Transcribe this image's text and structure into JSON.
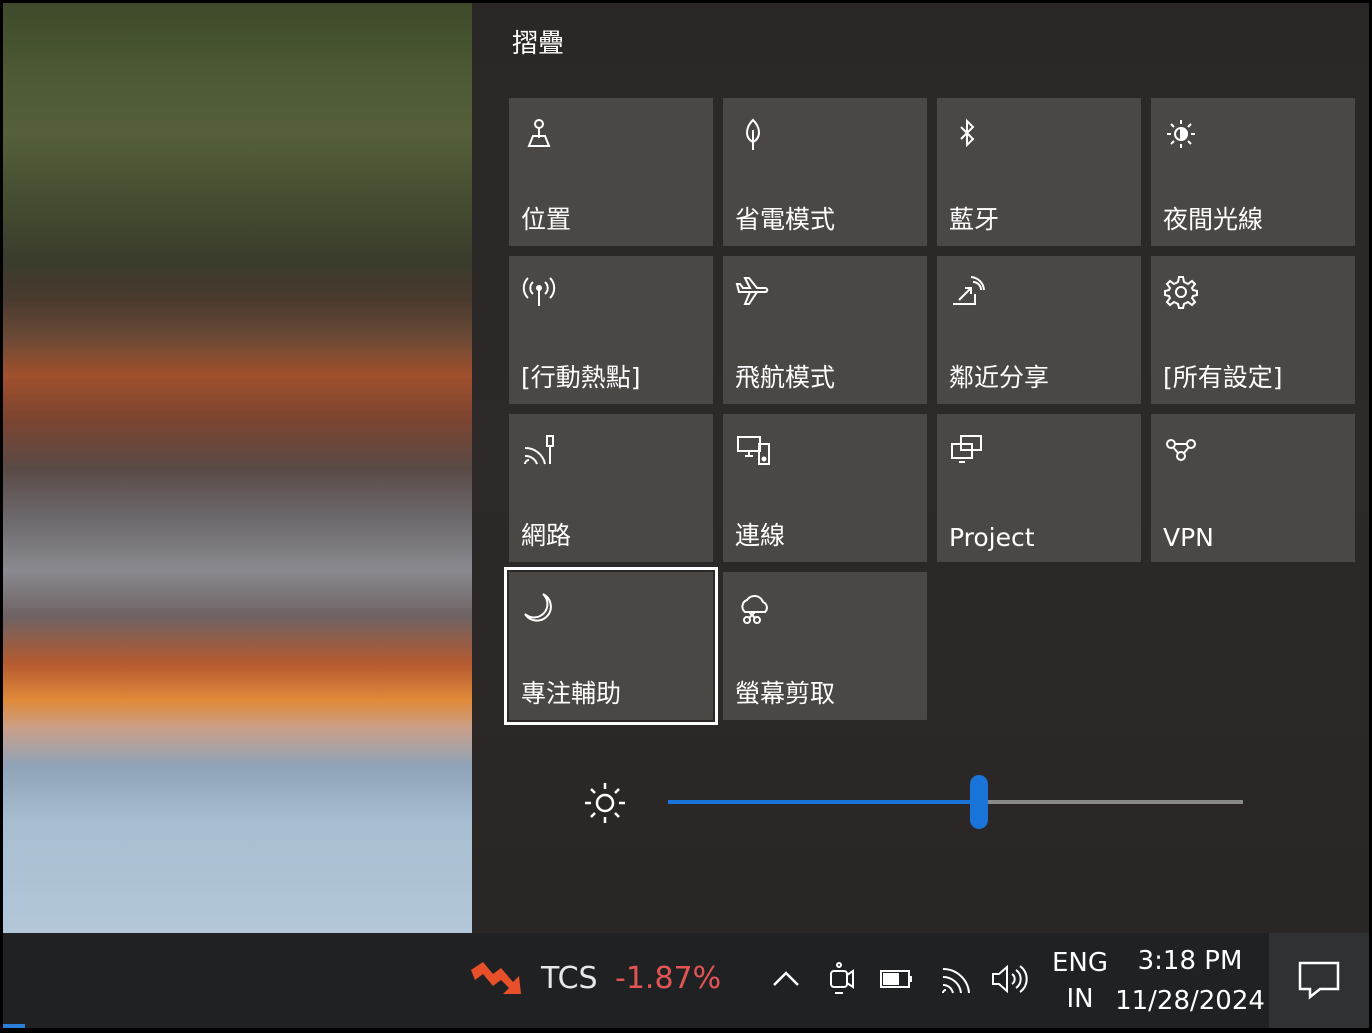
{
  "action_center": {
    "collapse_label": "摺疊",
    "tiles": [
      {
        "label": "位置",
        "icon": "location-icon"
      },
      {
        "label": "省電模式",
        "icon": "battery-saver-icon"
      },
      {
        "label": "藍牙",
        "icon": "bluetooth-icon"
      },
      {
        "label": "夜間光線",
        "icon": "night-light-icon"
      },
      {
        "label": "[行動熱點]",
        "icon": "mobile-hotspot-icon"
      },
      {
        "label": "飛航模式",
        "icon": "airplane-icon"
      },
      {
        "label": "鄰近分享",
        "icon": "nearby-share-icon"
      },
      {
        "label": "[所有設定]",
        "icon": "settings-gear-icon"
      },
      {
        "label": "網路",
        "icon": "network-icon"
      },
      {
        "label": "連線",
        "icon": "connect-icon"
      },
      {
        "label": "Project",
        "icon": "project-icon"
      },
      {
        "label": "VPN",
        "icon": "vpn-icon"
      },
      {
        "label": "專注輔助",
        "icon": "focus-assist-moon-icon",
        "focused": true
      },
      {
        "label": "螢幕剪取",
        "icon": "screen-snip-icon"
      }
    ],
    "brightness": {
      "icon": "brightness-sun-icon",
      "level_fraction": 0.54
    }
  },
  "taskbar": {
    "stock": {
      "ticker": "TCS",
      "change": "-1.87%",
      "icon": "stock-down-icon",
      "change_color": "#e55454"
    },
    "tray_icons": [
      "chevron-up-icon",
      "meet-now-icon",
      "battery-icon",
      "wifi-icon",
      "volume-icon"
    ],
    "language": {
      "line1": "ENG",
      "line2": "IN"
    },
    "clock": {
      "time": "3:18 PM",
      "date": "11/28/2024"
    },
    "notification_icon": "action-center-icon"
  },
  "colors": {
    "accent": "#1a73d9",
    "tile_bg": "#4b4745",
    "panel_bg": "#2b2726"
  }
}
